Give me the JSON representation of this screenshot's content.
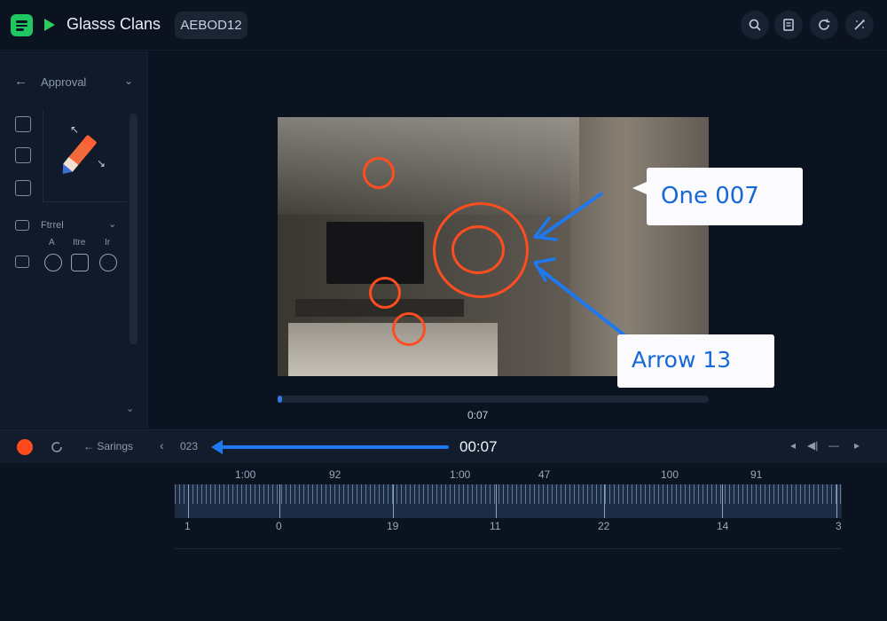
{
  "app": {
    "title": "Glasss Clans",
    "code": "AEBOD12"
  },
  "toolbar": {
    "icons": [
      "search-icon",
      "document-icon",
      "refresh-icon",
      "magic-icon"
    ]
  },
  "sidebar": {
    "section_title": "Approval",
    "filter_title": "Ftrrel",
    "option_labels": [
      "A",
      "Itre",
      "Ir"
    ]
  },
  "annotations": {
    "callout_1": "One 007",
    "callout_2": "Arrow 13"
  },
  "player": {
    "progress": 0.01,
    "time_small": "0:07"
  },
  "controls": {
    "settings_label": "← Sarings",
    "frame": "023",
    "time": "00:07"
  },
  "timeline": {
    "top_labels": [
      "1:00",
      "92",
      "1:00",
      "47",
      "100",
      "91"
    ],
    "bottom_labels": [
      "1",
      "0",
      "19",
      "11",
      "22",
      "14",
      "3"
    ]
  },
  "colors": {
    "accent": "#1ec760",
    "annotation_red": "#ff4d1f",
    "annotation_blue": "#1e78f0"
  }
}
